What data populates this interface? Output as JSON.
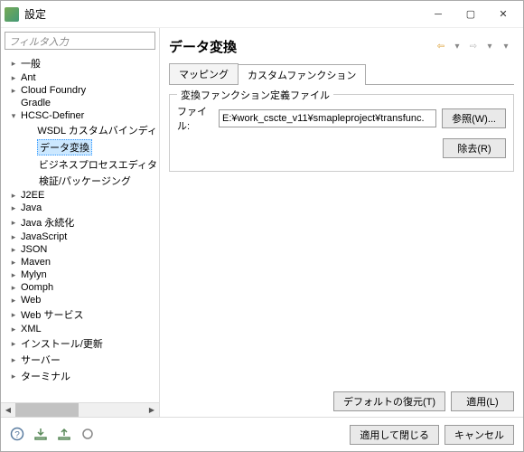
{
  "window": {
    "title": "設定"
  },
  "filter": {
    "placeholder": "フィルタ入力"
  },
  "tree": {
    "items": [
      {
        "label": "一般",
        "depth": 1,
        "chev": ">"
      },
      {
        "label": "Ant",
        "depth": 1,
        "chev": ">"
      },
      {
        "label": "Cloud Foundry",
        "depth": 1,
        "chev": ">"
      },
      {
        "label": "Gradle",
        "depth": 1,
        "chev": ""
      },
      {
        "label": "HCSC-Definer",
        "depth": 1,
        "chev": "v"
      },
      {
        "label": "WSDL カスタムバインディ",
        "depth": 2,
        "chev": ""
      },
      {
        "label": "データ変換",
        "depth": 2,
        "chev": "",
        "selected": true
      },
      {
        "label": "ビジネスプロセスエディタ",
        "depth": 2,
        "chev": ""
      },
      {
        "label": "検証/パッケージング",
        "depth": 2,
        "chev": ""
      },
      {
        "label": "J2EE",
        "depth": 1,
        "chev": ">"
      },
      {
        "label": "Java",
        "depth": 1,
        "chev": ">"
      },
      {
        "label": "Java 永続化",
        "depth": 1,
        "chev": ">"
      },
      {
        "label": "JavaScript",
        "depth": 1,
        "chev": ">"
      },
      {
        "label": "JSON",
        "depth": 1,
        "chev": ">"
      },
      {
        "label": "Maven",
        "depth": 1,
        "chev": ">"
      },
      {
        "label": "Mylyn",
        "depth": 1,
        "chev": ">"
      },
      {
        "label": "Oomph",
        "depth": 1,
        "chev": ">"
      },
      {
        "label": "Web",
        "depth": 1,
        "chev": ">"
      },
      {
        "label": "Web サービス",
        "depth": 1,
        "chev": ">"
      },
      {
        "label": "XML",
        "depth": 1,
        "chev": ">"
      },
      {
        "label": "インストール/更新",
        "depth": 1,
        "chev": ">"
      },
      {
        "label": "サーバー",
        "depth": 1,
        "chev": ">"
      },
      {
        "label": "ターミナル",
        "depth": 1,
        "chev": ">"
      }
    ]
  },
  "main": {
    "title": "データ変換",
    "tabs": {
      "mapping": "マッピング",
      "custom": "カスタムファンクション"
    },
    "group": {
      "legend": "変換ファンクション定義ファイル",
      "file_label": "ファイル:",
      "file_value": "E:¥work_cscte_v11¥smapleproject¥transfunc.",
      "browse": "参照(W)...",
      "remove": "除去(R)"
    },
    "buttons": {
      "restore": "デフォルトの復元(T)",
      "apply": "適用(L)"
    }
  },
  "footer": {
    "apply_close": "適用して閉じる",
    "cancel": "キャンセル"
  }
}
